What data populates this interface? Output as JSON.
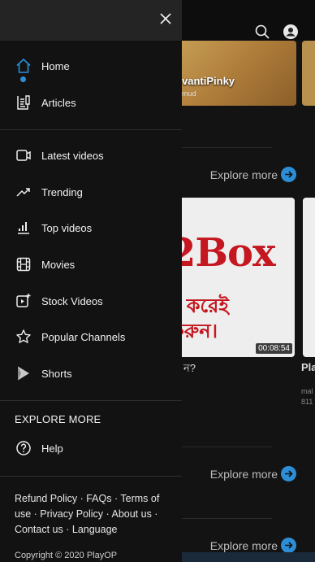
{
  "drawer": {
    "close_label": "×",
    "primary_items": [
      {
        "label": "Home",
        "icon": "home-icon",
        "active": true
      },
      {
        "label": "Articles",
        "icon": "articles-icon"
      }
    ],
    "video_items": [
      {
        "label": "Latest videos",
        "icon": "video-camera-icon"
      },
      {
        "label": "Trending",
        "icon": "trending-icon"
      },
      {
        "label": "Top videos",
        "icon": "bar-chart-icon"
      },
      {
        "label": "Movies",
        "icon": "film-icon"
      },
      {
        "label": "Stock Videos",
        "icon": "add-video-icon"
      },
      {
        "label": "Popular Channels",
        "icon": "star-icon"
      },
      {
        "label": "Shorts",
        "icon": "shorts-icon"
      }
    ],
    "explore_title": "EXPLORE MORE",
    "help_label": "Help",
    "footer": {
      "refund": "Refund Policy",
      "faqs": "FAQs",
      "terms": "Terms of use",
      "privacy": "Privacy Policy",
      "about": "About us",
      "contact": "Contact us",
      "language": "Language",
      "sep": " · "
    },
    "copyright": "Copyright © 2020 PlayOP"
  },
  "background": {
    "channel_name": "vantiPinky",
    "channel_sub": "mud",
    "explore_more": "Explore more",
    "video_brand": "2Box",
    "video_bengali": "ট করেই",
    "video_bengali_2": "করুন।",
    "video_duration": "00:08:54",
    "video_caption": "ন?",
    "side_caption": "Pla",
    "side_sub1": "mal",
    "side_sub2": "811"
  },
  "colors": {
    "accent": "#2d8ed6",
    "drawer_bg": "#121212",
    "drawer_header_bg": "#242424"
  }
}
